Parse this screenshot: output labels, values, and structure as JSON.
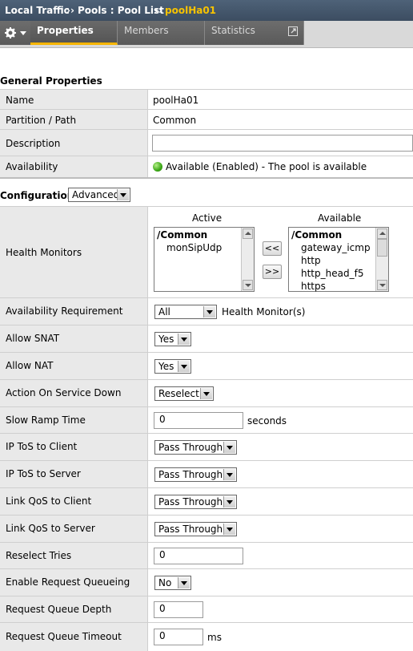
{
  "breadcrumb": {
    "part1": "Local Traffic",
    "sep1": "››",
    "part2": "Pools : Pool List",
    "sep2": "››",
    "current": "poolHa01"
  },
  "tabs": [
    {
      "label": "Properties",
      "active": true
    },
    {
      "label": "Members",
      "active": false
    },
    {
      "label": "Statistics",
      "active": false
    }
  ],
  "general": {
    "title": "General Properties",
    "name_label": "Name",
    "name_value": "poolHa01",
    "partition_label": "Partition / Path",
    "partition_value": "Common",
    "description_label": "Description",
    "description_value": "",
    "availability_label": "Availability",
    "availability_value": "Available (Enabled) - The pool is available"
  },
  "configuration": {
    "title": "Configuration:",
    "mode": "Advanced",
    "health_monitors": {
      "label": "Health Monitors",
      "active_header": "Active",
      "available_header": "Available",
      "active_items": [
        "/Common",
        "monSipUdp"
      ],
      "available_items": [
        "/Common",
        "gateway_icmp",
        "http",
        "http_head_f5",
        "https"
      ],
      "move_left": "<<",
      "move_right": ">>"
    },
    "availability_requirement": {
      "label": "Availability Requirement",
      "value": "All",
      "suffix": "Health Monitor(s)"
    },
    "allow_snat": {
      "label": "Allow SNAT",
      "value": "Yes"
    },
    "allow_nat": {
      "label": "Allow NAT",
      "value": "Yes"
    },
    "action_on_service_down": {
      "label": "Action On Service Down",
      "value": "Reselect"
    },
    "slow_ramp_time": {
      "label": "Slow Ramp Time",
      "value": "0",
      "suffix": "seconds"
    },
    "ip_tos_client": {
      "label": "IP ToS to Client",
      "value": "Pass Through"
    },
    "ip_tos_server": {
      "label": "IP ToS to Server",
      "value": "Pass Through"
    },
    "link_qos_client": {
      "label": "Link QoS to Client",
      "value": "Pass Through"
    },
    "link_qos_server": {
      "label": "Link QoS to Server",
      "value": "Pass Through"
    },
    "reselect_tries": {
      "label": "Reselect Tries",
      "value": "0"
    },
    "enable_request_queueing": {
      "label": "Enable Request Queueing",
      "value": "No"
    },
    "request_queue_depth": {
      "label": "Request Queue Depth",
      "value": "0"
    },
    "request_queue_timeout": {
      "label": "Request Queue Timeout",
      "value": "0",
      "suffix": "ms"
    }
  },
  "colors": {
    "accent": "#f7c300",
    "header_bg": "#4e6278",
    "status_green": "#3aa615"
  }
}
